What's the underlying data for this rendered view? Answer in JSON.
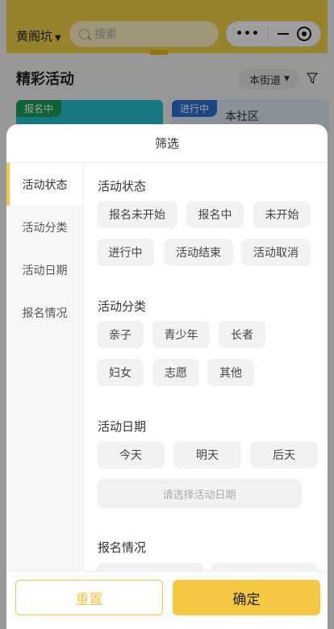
{
  "header": {
    "location": "黄阁坑",
    "search_placeholder": "搜索"
  },
  "page": {
    "section_title": "精彩活动",
    "street_select": "本街道",
    "card1_tag": "报名中",
    "card2_tag": "进行中",
    "card2_text": "本社区"
  },
  "filter": {
    "title": "筛选",
    "tabs": [
      "活动状态",
      "活动分类",
      "活动日期",
      "报名情况"
    ],
    "groups": {
      "status": {
        "title": "活动状态",
        "options": [
          "报名未开始",
          "报名中",
          "未开始",
          "进行中",
          "活动结束",
          "活动取消"
        ]
      },
      "category": {
        "title": "活动分类",
        "options": [
          "亲子",
          "青少年",
          "长者",
          "妇女",
          "志愿",
          "其他"
        ]
      },
      "date": {
        "title": "活动日期",
        "options": [
          "今天",
          "明天",
          "后天"
        ],
        "picker_placeholder": "请选择活动日期"
      },
      "signup": {
        "title": "报名情况"
      }
    },
    "reset_label": "重置",
    "confirm_label": "确定"
  },
  "colors": {
    "accent": "#f5c842",
    "topbar": "#f5d34a"
  }
}
